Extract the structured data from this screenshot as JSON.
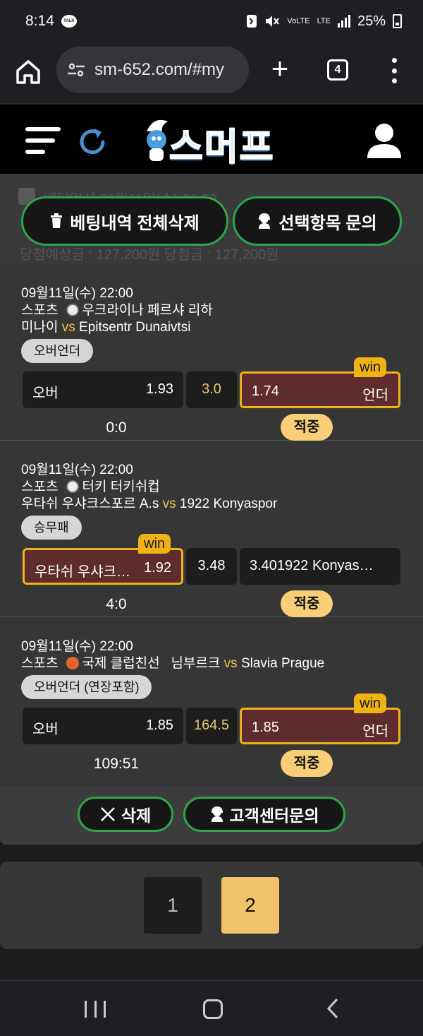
{
  "status_bar": {
    "time": "8:14",
    "talk_label": "TALK",
    "volte_label": "VoLTE",
    "lte_label": "LTE",
    "battery": "25%"
  },
  "browser": {
    "url": "sm-652.com/#my",
    "tab_count": "4"
  },
  "header": {
    "logo_text": "스머프"
  },
  "bet_history": {
    "ghost_date": "배팅일시 09월11일(수) 21:52",
    "ghost_amounts": "당첨예상금 : 127,200원   당첨금 : 127,200원",
    "delete_all_label": "베팅내역 전체삭제",
    "inquire_selected_label": "선택항목 문의",
    "vs_label": "vs",
    "win_label": "win",
    "bets": [
      {
        "datetime": "09월11일(수) 22:00",
        "sport": "스포츠",
        "league": "우크라이나 페르샤 리하",
        "home": "미나이",
        "away": "Epitsentr Dunaivtsi",
        "market": "오버언더",
        "left_label": "오버",
        "left_odds": "1.93",
        "middle": "3.0",
        "right_label": "언더",
        "right_odds": "1.74",
        "score": "0:0",
        "result": "적중"
      },
      {
        "datetime": "09월11일(수) 22:00",
        "sport": "스포츠",
        "league": "터키 터키쉬컵",
        "home": "우타쉬 우샤크스포르 A.s",
        "away": "1922 Konyaspor",
        "market": "승무패",
        "left_label": "우타쉬 우샤크…",
        "left_odds": "1.92",
        "middle": "3.48",
        "right_label": "3.401922 Konyas…",
        "score": "4:0",
        "result": "적중"
      },
      {
        "datetime": "09월11일(수) 22:00",
        "sport": "스포츠",
        "league": "국제 클럽친선",
        "home": "님부르크",
        "away": "Slavia Prague",
        "market": "오버언더 (연장포함)",
        "left_label": "오버",
        "left_odds": "1.85",
        "middle": "164.5",
        "right_label": "언더",
        "right_odds": "1.85",
        "score": "109:51",
        "result": "적중"
      }
    ],
    "delete_label": "삭제",
    "support_label": "고객센터문의"
  },
  "pagination": {
    "pages": [
      "1",
      "2"
    ],
    "current": "2"
  },
  "colors": {
    "accent_green": "#2ea44f",
    "win_gold": "#f0b315",
    "result_badge": "#f8ce77",
    "selected_pick": "#5e2b2e",
    "logo_blue": "#4fb1f0"
  }
}
